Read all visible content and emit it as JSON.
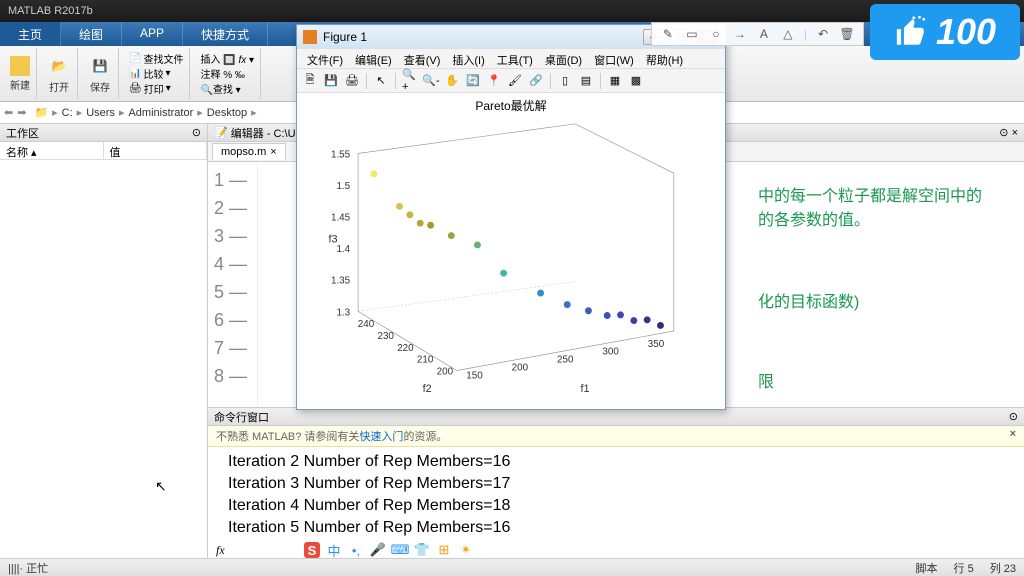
{
  "app_title": "MATLAB R2017b",
  "ribbon_tabs": [
    "主页",
    "绘图",
    "APP",
    "快捷方式"
  ],
  "toolstrip": {
    "new": "新建",
    "open": "打开",
    "save": "保存",
    "findfiles": "查找文件",
    "compare": "比较",
    "print": "打印",
    "insert": "插入",
    "comment": "注释",
    "find": "查找"
  },
  "path": [
    "C:",
    "Users",
    "Administrator",
    "Desktop"
  ],
  "workspace": {
    "title": "工作区",
    "col_name": "名称",
    "col_value": "值"
  },
  "editor": {
    "title": "编辑器 - C:\\User",
    "tab": "mopso.m",
    "line_count": 8
  },
  "green_comments": {
    "l1": "中的每一个粒子都是解空间中的",
    "l2": "的各参数的值。",
    "l3": "化的目标函数)",
    "l4": "限"
  },
  "cmd": {
    "title": "命令行窗口",
    "hint_pre": "不熟悉 MATLAB? 请参阅有关",
    "hint_link": "快速入门",
    "hint_post": "的资源。",
    "lines": [
      "Iteration 2 Number of Rep Members=16",
      "Iteration 3 Number of Rep Members=17",
      "Iteration 4 Number of Rep Members=18",
      "Iteration 5 Number of Rep Members=16"
    ],
    "prompt": "fx"
  },
  "status": {
    "left": "正忙",
    "script": "脚本",
    "line": "行",
    "line_n": "5",
    "col": "列",
    "col_n": "23"
  },
  "figure": {
    "title": "Figure 1",
    "menus": [
      "文件(F)",
      "编辑(E)",
      "查看(V)",
      "插入(I)",
      "工具(T)",
      "桌面(D)",
      "窗口(W)",
      "帮助(H)"
    ],
    "plot_title": "Pareto最优解",
    "xlabel": "f1",
    "ylabel": "f2",
    "zlabel": "f3"
  },
  "chart_data": {
    "type": "scatter",
    "title": "Pareto最优解",
    "xlabel": "f1",
    "ylabel": "f2",
    "zlabel": "f3",
    "xlim": [
      150,
      350
    ],
    "xticks": [
      150,
      200,
      250,
      300,
      350
    ],
    "ylim": [
      200,
      240
    ],
    "yticks": [
      200,
      210,
      220,
      230,
      240
    ],
    "zlim": [
      1.3,
      1.55
    ],
    "zticks": [
      1.3,
      1.35,
      1.4,
      1.45,
      1.5,
      1.55
    ],
    "points": [
      {
        "f1": 160,
        "f2": 238,
        "f3": 1.52,
        "c": "#f5e663"
      },
      {
        "f1": 170,
        "f2": 232,
        "f3": 1.48,
        "c": "#d7c24a"
      },
      {
        "f1": 175,
        "f2": 230,
        "f3": 1.47,
        "c": "#c8b33f"
      },
      {
        "f1": 180,
        "f2": 228,
        "f3": 1.46,
        "c": "#b9a536"
      },
      {
        "f1": 185,
        "f2": 226,
        "f3": 1.46,
        "c": "#ab972f"
      },
      {
        "f1": 195,
        "f2": 222,
        "f3": 1.45,
        "c": "#8ea843"
      },
      {
        "f1": 210,
        "f2": 218,
        "f3": 1.44,
        "c": "#64b36a"
      },
      {
        "f1": 225,
        "f2": 214,
        "f3": 1.4,
        "c": "#3fb9a0"
      },
      {
        "f1": 250,
        "f2": 210,
        "f3": 1.37,
        "c": "#2f8fc2"
      },
      {
        "f1": 270,
        "f2": 208,
        "f3": 1.35,
        "c": "#3a6fc9"
      },
      {
        "f1": 285,
        "f2": 206,
        "f3": 1.34,
        "c": "#3d5dc4"
      },
      {
        "f1": 300,
        "f2": 205,
        "f3": 1.33,
        "c": "#3f4fbf"
      },
      {
        "f1": 310,
        "f2": 204,
        "f3": 1.33,
        "c": "#3e46b8"
      },
      {
        "f1": 320,
        "f2": 203,
        "f3": 1.32,
        "c": "#3b3da8"
      },
      {
        "f1": 330,
        "f2": 202,
        "f3": 1.32,
        "c": "#353494"
      },
      {
        "f1": 340,
        "f2": 201,
        "f3": 1.31,
        "c": "#2f2d82"
      }
    ]
  },
  "like_badge": "100"
}
